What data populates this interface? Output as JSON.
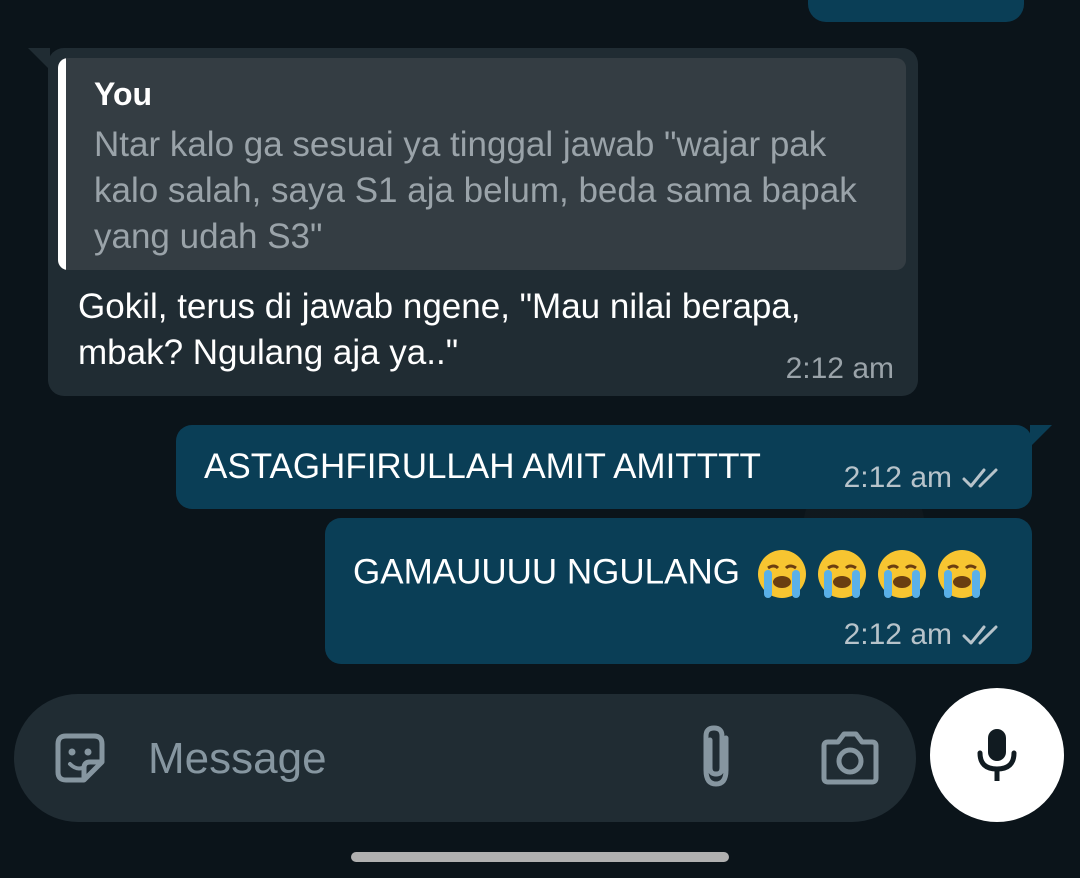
{
  "conversation": {
    "incoming": {
      "quote_author": "You",
      "quote_text": "Ntar kalo ga sesuai ya tinggal jawab \"wajar pak kalo salah, saya S1 aja belum, beda sama bapak yang udah S3\"",
      "text": "Gokil, terus di jawab ngene, \"Mau nilai berapa, mbak? Ngulang aja ya..\"",
      "time": "2:12 am"
    },
    "outgoing": [
      {
        "text": "ASTAGHFIRULLAH AMIT AMITTTT",
        "time": "2:12 am",
        "status": "read"
      },
      {
        "text": "GAMAUUUU NGULANG",
        "emoji": [
          "loudly-crying-face",
          "loudly-crying-face",
          "loudly-crying-face",
          "loudly-crying-face"
        ],
        "time": "2:12 am",
        "status": "read"
      }
    ]
  },
  "composer": {
    "placeholder": "Message",
    "icons": [
      "sticker-icon",
      "attach-icon",
      "camera-icon",
      "mic-icon"
    ]
  },
  "colors": {
    "background": "#0b141a",
    "incoming_bubble": "#202c33",
    "outgoing_bubble": "#0a3e56",
    "quote_background": "#343d43"
  }
}
